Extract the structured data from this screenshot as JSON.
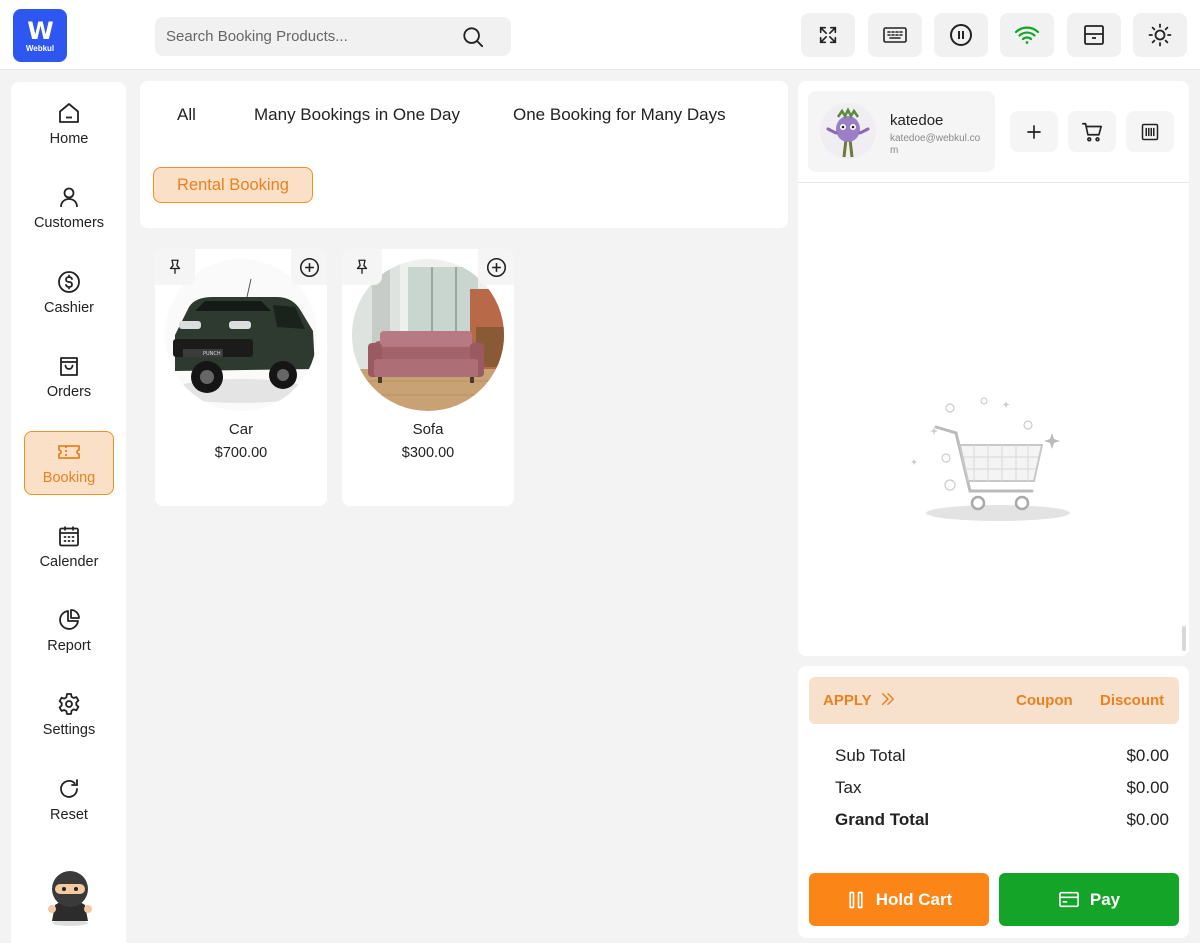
{
  "brand": {
    "logo_letter": "W",
    "logo_text": "Webkul",
    "color": "#2d57f0"
  },
  "search": {
    "placeholder": "Search Booking Products..."
  },
  "toolbar": {
    "icons": [
      "fullscreen-icon",
      "keyboard-icon",
      "pause-icon",
      "wifi-icon",
      "drawer-icon",
      "sun-icon"
    ],
    "wifi_color": "#13a428"
  },
  "sidebar": {
    "items": [
      {
        "label": "Home",
        "icon": "home-icon"
      },
      {
        "label": "Customers",
        "icon": "user-icon"
      },
      {
        "label": "Cashier",
        "icon": "dollar-icon"
      },
      {
        "label": "Orders",
        "icon": "bag-icon"
      },
      {
        "label": "Booking",
        "icon": "ticket-icon",
        "active": true
      },
      {
        "label": "Calender",
        "icon": "calendar-icon"
      },
      {
        "label": "Report",
        "icon": "pie-chart-icon"
      },
      {
        "label": "Settings",
        "icon": "gear-icon"
      },
      {
        "label": "Reset",
        "icon": "reset-icon"
      }
    ]
  },
  "categories": {
    "tabs": [
      "All",
      "Many Bookings in One Day",
      "One Booking for Many Days"
    ],
    "selected": "Rental Booking"
  },
  "products": [
    {
      "name": "Car",
      "price": "$700.00"
    },
    {
      "name": "Sofa",
      "price": "$300.00"
    }
  ],
  "customer": {
    "name": "katedoe",
    "email": "katedoe@webkul.com"
  },
  "totals": {
    "apply_label": "APPLY",
    "coupon_label": "Coupon",
    "discount_label": "Discount",
    "sub_total_label": "Sub Total",
    "sub_total": "$0.00",
    "tax_label": "Tax",
    "tax": "$0.00",
    "grand_total_label": "Grand Total",
    "grand_total": "$0.00"
  },
  "actions": {
    "hold_cart": "Hold Cart",
    "pay": "Pay"
  },
  "colors": {
    "accent": "#fb8517",
    "accent_light": "#fbe0c8",
    "pay": "#13a428"
  }
}
